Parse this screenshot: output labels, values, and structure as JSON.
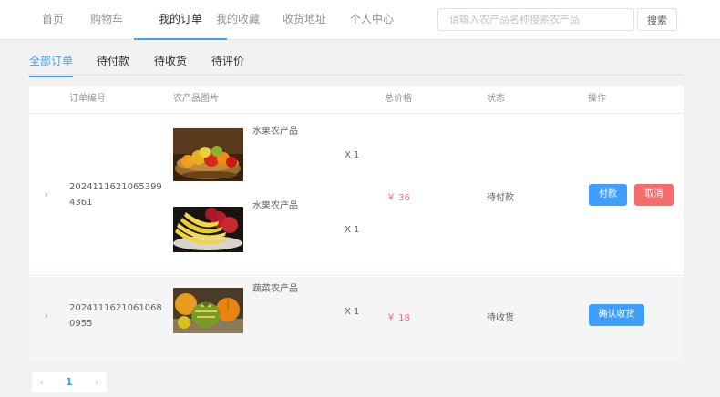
{
  "nav": {
    "items": [
      {
        "label": "首页",
        "active": false
      },
      {
        "label": "购物车",
        "active": false
      },
      {
        "label": "我的订单",
        "active": true
      },
      {
        "label": "我的收藏",
        "active": false
      },
      {
        "label": "收货地址",
        "active": false
      },
      {
        "label": "个人中心",
        "active": false
      }
    ],
    "search_placeholder": "请输入农产品名称搜索农产品",
    "search_value": "",
    "search_button": "搜索"
  },
  "tabs": [
    {
      "label": "全部订单",
      "active": true
    },
    {
      "label": "待付款",
      "active": false
    },
    {
      "label": "待收货",
      "active": false
    },
    {
      "label": "待评价",
      "active": false
    }
  ],
  "table": {
    "headers": {
      "order_no": "订单编号",
      "image": "农产品图片",
      "total": "总价格",
      "status": "状态",
      "actions": "操作"
    },
    "orders": [
      {
        "order_no": "20241116210653994361",
        "products": [
          {
            "name": "水果农产品",
            "qty": "X 1",
            "image": "fruit-basket-photo"
          },
          {
            "name": "水果农产品",
            "qty": "X 1",
            "image": "bananas-apples-photo"
          }
        ],
        "total": "￥ 36",
        "status": "待付款",
        "actions": [
          {
            "label": "付款",
            "type": "primary"
          },
          {
            "label": "取消",
            "type": "danger"
          }
        ]
      },
      {
        "order_no": "20241116210610680955",
        "products": [
          {
            "name": "蔬菜农产品",
            "qty": "X 1",
            "image": "squash-pumpkins-photo"
          }
        ],
        "total": "￥ 18",
        "status": "待收货",
        "actions": [
          {
            "label": "确认收货",
            "type": "primary"
          }
        ]
      }
    ]
  },
  "pagination": {
    "prev": "‹",
    "current": "1",
    "next": "›"
  },
  "colors": {
    "accent": "#409eff",
    "danger": "#f56c6c",
    "price": "#f56c6c"
  }
}
